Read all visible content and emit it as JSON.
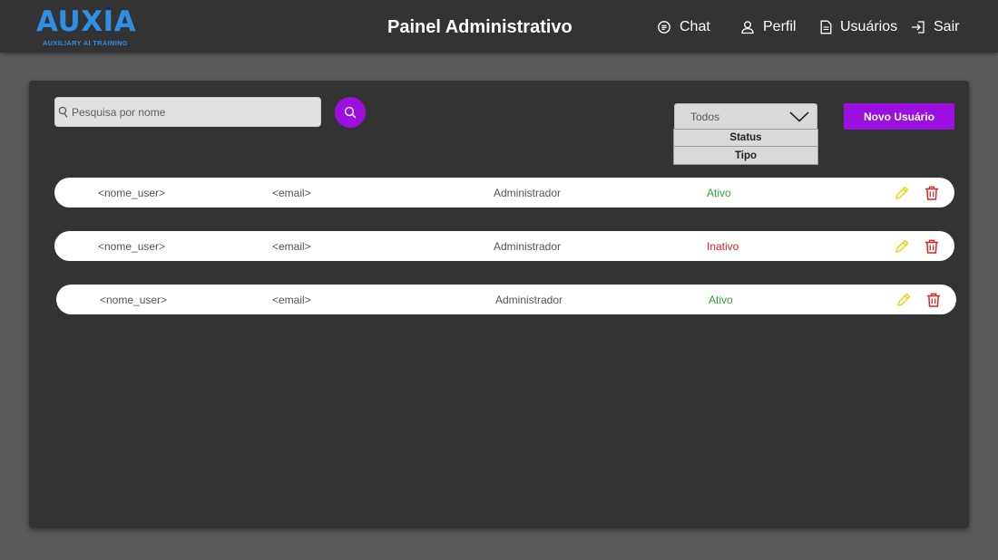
{
  "header": {
    "logo_text": "AUXIA",
    "logo_tagline": "AUXILIARY AI TRAINING",
    "title": "Painel Administrativo",
    "nav": [
      {
        "label": "Chat",
        "icon": "chat-icon"
      },
      {
        "label": "Perfil",
        "icon": "user-icon"
      },
      {
        "label": "Usuários",
        "icon": "document-icon"
      },
      {
        "label": "Sair",
        "icon": "logout-icon"
      }
    ]
  },
  "toolbar": {
    "search_placeholder": "Pesquisa por nome",
    "search_value": "",
    "filter_selected": "Todos",
    "filter_options": [
      "Status",
      "Tipo"
    ],
    "new_user_label": "Novo Usuário"
  },
  "users": [
    {
      "name": "<nome_user>",
      "email": "<email>",
      "role": "Administrador",
      "status": "Ativo"
    },
    {
      "name": "<nome_user>",
      "email": "<email>",
      "role": "Administrador",
      "status": "Inativo"
    },
    {
      "name": "<nome_user>",
      "email": "<email>",
      "role": "Administrador",
      "status": "Ativo"
    }
  ],
  "colors": {
    "accent": "#9b10e0",
    "brand": "#2e8fe6",
    "status_active": "#2fa52f",
    "status_inactive": "#e02424",
    "edit_icon": "#f0d000",
    "delete_icon": "#e02424"
  }
}
